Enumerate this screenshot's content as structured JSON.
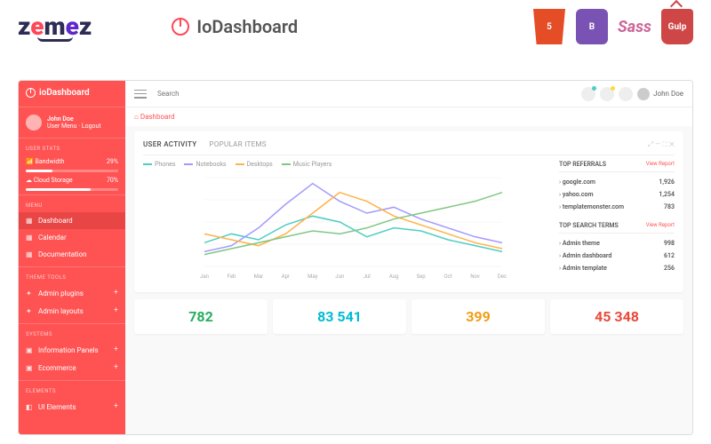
{
  "top": {
    "zemez": "zemez",
    "io_brand": "IoDashboard",
    "tech": {
      "html5": "HTML5",
      "bootstrap": "B",
      "sass": "Sass",
      "gulp": "Gulp"
    }
  },
  "sidebar": {
    "brand": "ioDashboard",
    "user": {
      "name": "John Doe",
      "sub": "User Menu · Logout"
    },
    "sections": {
      "stats": "USER STATS",
      "menu": "MENU",
      "theme": "THEME TOOLS",
      "systems": "SYSTEMS",
      "elements": "ELEMENTS"
    },
    "stats": [
      {
        "label": "Bandwidth",
        "value": "29%",
        "pct": 29
      },
      {
        "label": "Cloud Storage",
        "value": "70%",
        "pct": 70
      }
    ],
    "menu": [
      {
        "label": "Dashboard",
        "active": true
      },
      {
        "label": "Calendar"
      },
      {
        "label": "Documentation"
      }
    ],
    "theme": [
      {
        "label": "Admin plugins"
      },
      {
        "label": "Admin layouts"
      }
    ],
    "systems": [
      {
        "label": "Information Panels"
      },
      {
        "label": "Ecommerce"
      }
    ],
    "elements": [
      {
        "label": "UI Elements"
      }
    ]
  },
  "topbar": {
    "search": "Search",
    "user": "John Doe",
    "dots": [
      "#4ecdc4",
      "#ffd93d",
      "#6c5ce7"
    ]
  },
  "breadcrumb": "Dashboard",
  "tabs": [
    {
      "label": "USER ACTIVITY",
      "active": true
    },
    {
      "label": "POPULAR ITEMS"
    }
  ],
  "chart_data": {
    "type": "line",
    "categories": [
      "Jan",
      "Feb",
      "Mar",
      "Apr",
      "May",
      "Jun",
      "Jul",
      "Aug",
      "Sep",
      "Oct",
      "Nov",
      "Dec"
    ],
    "series": [
      {
        "name": "Phones",
        "color": "#4ecdc4",
        "values": [
          8,
          11,
          9,
          14,
          17,
          15,
          10,
          13,
          12,
          9,
          7,
          5
        ]
      },
      {
        "name": "Notebooks",
        "color": "#a29bfe",
        "values": [
          5,
          7,
          13,
          21,
          28,
          22,
          18,
          20,
          16,
          13,
          10,
          8
        ]
      },
      {
        "name": "Desktops",
        "color": "#ffb347",
        "values": [
          11,
          9,
          7,
          11,
          18,
          25,
          22,
          17,
          14,
          11,
          8,
          6
        ]
      },
      {
        "name": "Music Players",
        "color": "#81c784",
        "values": [
          4,
          6,
          8,
          10,
          12,
          11,
          13,
          16,
          18,
          20,
          22,
          25
        ]
      }
    ],
    "ylim": [
      0,
      30
    ]
  },
  "referrals": {
    "title": "TOP REFERRALS",
    "link": "View Report",
    "rows": [
      {
        "name": "google.com",
        "val": "1,926"
      },
      {
        "name": "yahoo.com",
        "val": "1,254"
      },
      {
        "name": "templatemonster.com",
        "val": "783"
      }
    ]
  },
  "searchterms": {
    "title": "TOP SEARCH TERMS",
    "link": "View Report",
    "rows": [
      {
        "name": "Admin theme",
        "val": "998"
      },
      {
        "name": "Admin dashboard",
        "val": "612"
      },
      {
        "name": "Admin template",
        "val": "256"
      }
    ]
  },
  "stats": [
    {
      "val": "782",
      "cls": "c-green"
    },
    {
      "val": "83 541",
      "cls": "c-blue"
    },
    {
      "val": "399",
      "cls": "c-orange"
    },
    {
      "val": "45 348",
      "cls": "c-red"
    }
  ]
}
